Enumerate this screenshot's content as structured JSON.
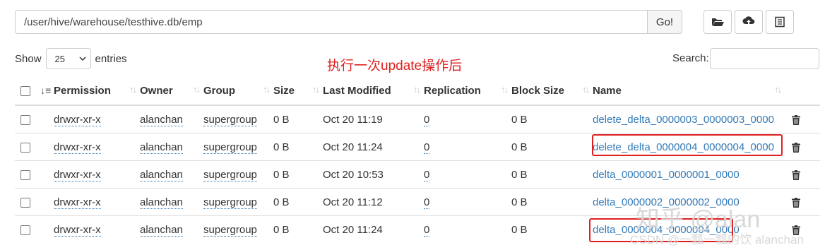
{
  "toolbar": {
    "path_value": "/user/hive/warehouse/testhive.db/emp",
    "go_label": "Go!",
    "icons": [
      "folder-open-icon",
      "upload-icon",
      "list-alt-icon"
    ]
  },
  "controls": {
    "show_label": "Show",
    "entries_value": "25",
    "entries_label": "entries",
    "search_label": "Search:"
  },
  "annotation": "执行一次update操作后",
  "table": {
    "headers": [
      "Permission",
      "Owner",
      "Group",
      "Size",
      "Last Modified",
      "Replication",
      "Block Size",
      "Name"
    ],
    "rows": [
      {
        "permission": "drwxr-xr-x",
        "owner": "alanchan",
        "group": "supergroup",
        "size": "0 B",
        "modified": "Oct 20 11:19",
        "replication": "0",
        "block_size": "0 B",
        "name": "delete_delta_0000003_0000003_0000"
      },
      {
        "permission": "drwxr-xr-x",
        "owner": "alanchan",
        "group": "supergroup",
        "size": "0 B",
        "modified": "Oct 20 11:24",
        "replication": "0",
        "block_size": "0 B",
        "name": "delete_delta_0000004_0000004_0000"
      },
      {
        "permission": "drwxr-xr-x",
        "owner": "alanchan",
        "group": "supergroup",
        "size": "0 B",
        "modified": "Oct 20 10:53",
        "replication": "0",
        "block_size": "0 B",
        "name": "delta_0000001_0000001_0000"
      },
      {
        "permission": "drwxr-xr-x",
        "owner": "alanchan",
        "group": "supergroup",
        "size": "0 B",
        "modified": "Oct 20 11:12",
        "replication": "0",
        "block_size": "0 B",
        "name": "delta_0000002_0000002_0000"
      },
      {
        "permission": "drwxr-xr-x",
        "owner": "alanchan",
        "group": "supergroup",
        "size": "0 B",
        "modified": "Oct 20 11:24",
        "replication": "0",
        "block_size": "0 B",
        "name": "delta_0000004_0000004_0000"
      }
    ]
  },
  "watermark": {
    "line1": "知乎 @alan",
    "line2": "CSDN @一瓢一瓢的饮 alanchan"
  },
  "colors": {
    "link": "#337ab7",
    "highlight": "#e02020",
    "annotation": "#e02020"
  }
}
